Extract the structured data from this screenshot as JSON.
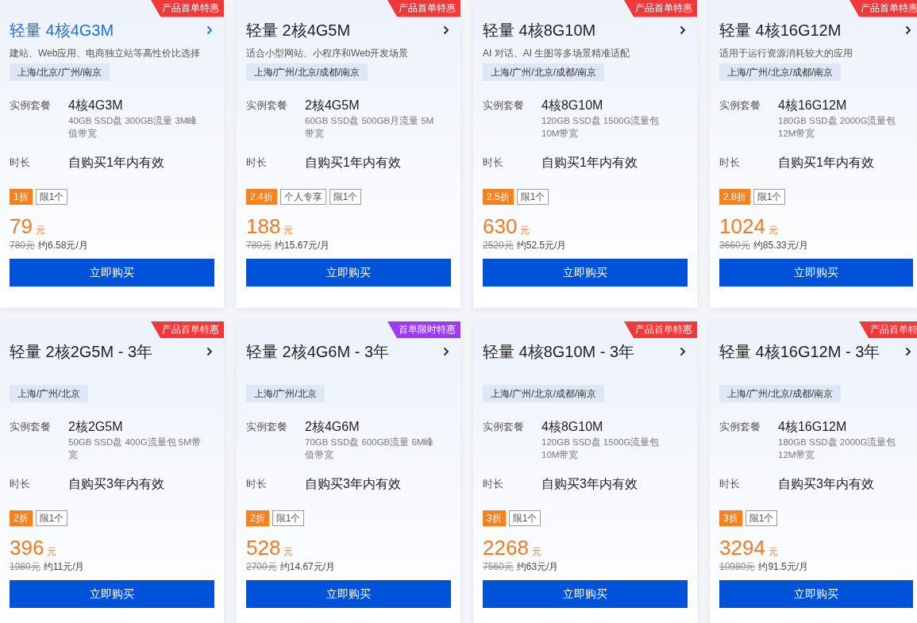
{
  "cards": [
    {
      "badge": {
        "text": "产品首单特惠",
        "color": "#f0393b"
      },
      "title": "轻量 4核4G3M",
      "subtitle": "建站、Web应用、电商独立站等高性价比选择",
      "selected": true,
      "regions": "上海/北京/广州/南京",
      "spec_label": "实例套餐",
      "spec_name": "4核4G3M",
      "spec_detail": "40GB SSD盘 300GB流量 3M峰值带宽",
      "duration_label": "时长",
      "duration": "自购买1年内有效",
      "tags": [
        {
          "text": "1折",
          "kind": "discount"
        },
        {
          "text": "限1个",
          "kind": "limit"
        }
      ],
      "price": "79",
      "price_unit": "元",
      "original_price": "780元",
      "monthly": "约6.58元/月",
      "buy_button": "立即购买"
    },
    {
      "badge": {
        "text": "产品首单特惠",
        "color": "#f0393b"
      },
      "title": "轻量 2核4G5M",
      "subtitle": "适合小型网站、小程序和Web开发场景",
      "selected": false,
      "regions": "上海/广州/北京/成都/南京",
      "spec_label": "实例套餐",
      "spec_name": "2核4G5M",
      "spec_detail": "60GB SSD盘 500GB月流量 5M带宽",
      "duration_label": "时长",
      "duration": "自购买1年内有效",
      "tags": [
        {
          "text": "2.4折",
          "kind": "discount"
        },
        {
          "text": "个人专享",
          "kind": "limit"
        },
        {
          "text": "限1个",
          "kind": "limit"
        }
      ],
      "price": "188",
      "price_unit": "元",
      "original_price": "780元",
      "monthly": "约15.67元/月",
      "buy_button": "立即购买"
    },
    {
      "badge": {
        "text": "产品首单特惠",
        "color": "#f0393b"
      },
      "title": "轻量 4核8G10M",
      "subtitle": "AI 对话、AI 生图等多场景精准适配",
      "selected": false,
      "regions": "上海/广州/北京/成都/南京",
      "spec_label": "实例套餐",
      "spec_name": "4核8G10M",
      "spec_detail": "120GB SSD盘 1500G流量包 10M带宽",
      "duration_label": "时长",
      "duration": "自购买1年内有效",
      "tags": [
        {
          "text": "2.5折",
          "kind": "discount"
        },
        {
          "text": "限1个",
          "kind": "limit"
        }
      ],
      "price": "630",
      "price_unit": "元",
      "original_price": "2520元",
      "monthly": "约52.5元/月",
      "buy_button": "立即购买"
    },
    {
      "badge": {
        "text": "产品首单特惠",
        "color": "#f0393b"
      },
      "title": "轻量 4核16G12M",
      "subtitle": "适用于运行资源消耗较大的应用",
      "selected": false,
      "regions": "上海/广州/北京/成都/南京",
      "spec_label": "实例套餐",
      "spec_name": "4核16G12M",
      "spec_detail": "180GB SSD盘 2000G流量包 12M带宽",
      "duration_label": "时长",
      "duration": "自购买1年内有效",
      "tags": [
        {
          "text": "2.8折",
          "kind": "discount"
        },
        {
          "text": "限1个",
          "kind": "limit"
        }
      ],
      "price": "1024",
      "price_unit": "元",
      "original_price": "3660元",
      "monthly": "约85.33元/月",
      "buy_button": "立即购买"
    },
    {
      "badge": {
        "text": "产品首单特惠",
        "color": "#f0393b"
      },
      "title": "轻量 2核2G5M - 3年",
      "selected": false,
      "regions": "上海/广州/北京",
      "spec_label": "实例套餐",
      "spec_name": "2核2G5M",
      "spec_detail": "50GB SSD盘 400G流量包 5M带宽",
      "duration_label": "时长",
      "duration": "自购买3年内有效",
      "tags": [
        {
          "text": "2折",
          "kind": "discount"
        },
        {
          "text": "限1个",
          "kind": "limit"
        }
      ],
      "price": "396",
      "price_unit": "元",
      "original_price": "1980元",
      "monthly": "约11元/月",
      "buy_button": "立即购买"
    },
    {
      "badge": {
        "text": "首单限时特惠",
        "color": "#9b3cf2"
      },
      "title": "轻量 2核4G6M - 3年",
      "selected": false,
      "regions": "上海/广州/北京",
      "spec_label": "实例套餐",
      "spec_name": "2核4G6M",
      "spec_detail": "70GB SSD盘 600GB流量 6M峰值带宽",
      "duration_label": "时长",
      "duration": "自购买3年内有效",
      "tags": [
        {
          "text": "2折",
          "kind": "discount"
        },
        {
          "text": "限1个",
          "kind": "limit"
        }
      ],
      "price": "528",
      "price_unit": "元",
      "original_price": "2700元",
      "monthly": "约14.67元/月",
      "buy_button": "立即购买"
    },
    {
      "badge": {
        "text": "产品首单特惠",
        "color": "#f0393b"
      },
      "title": "轻量 4核8G10M - 3年",
      "selected": false,
      "regions": "上海/广州/北京/成都/南京",
      "spec_label": "实例套餐",
      "spec_name": "4核8G10M",
      "spec_detail": "120GB SSD盘 1500G流量包 10M带宽",
      "duration_label": "时长",
      "duration": "自购买3年内有效",
      "tags": [
        {
          "text": "3折",
          "kind": "discount"
        },
        {
          "text": "限1个",
          "kind": "limit"
        }
      ],
      "price": "2268",
      "price_unit": "元",
      "original_price": "7560元",
      "monthly": "约63元/月",
      "buy_button": "立即购买"
    },
    {
      "badge": {
        "text": "产品首单特",
        "color": "#f0393b"
      },
      "title": "轻量 4核16G12M - 3年",
      "selected": false,
      "regions": "上海/广州/北京/成都/南京",
      "spec_label": "实例套餐",
      "spec_name": "4核16G12M",
      "spec_detail": "180GB SSD盘 2000G流量包 12M带宽",
      "duration_label": "时长",
      "duration": "自购买3年内有效",
      "tags": [
        {
          "text": "3折",
          "kind": "discount"
        },
        {
          "text": "限1个",
          "kind": "limit"
        }
      ],
      "price": "3294",
      "price_unit": "元",
      "original_price": "10980元",
      "monthly": "约91.5元/月",
      "buy_button": "立即购买"
    }
  ]
}
